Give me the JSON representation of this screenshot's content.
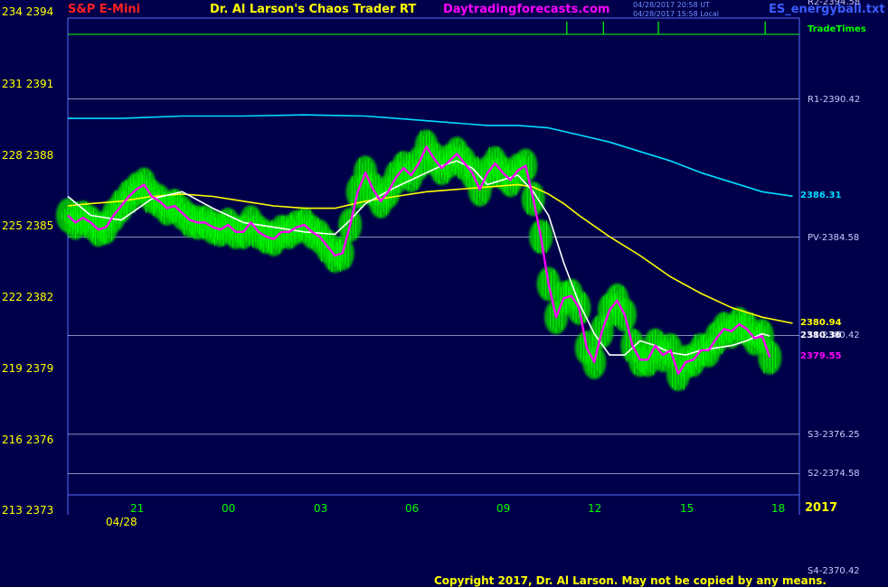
{
  "header": {
    "symbol": "S&P E-Mini",
    "app_title": "Dr. Al Larson's Chaos Trader RT",
    "website": "Daytradingforecasts.com",
    "file": "ES_energyball.txt",
    "timestamp1": "04/28/2017 20:58 UT",
    "timestamp2": "04/28/2017 15:58 Local",
    "top_left_price": "234 2394"
  },
  "trade_times_label": "TradeTimes",
  "year": "2017",
  "date_label": "04/28",
  "copyright": "Copyright 2017, Dr. Al Larson. May not be copied by any means.",
  "colors": {
    "background": "#00004a",
    "frame": "#5a6cff",
    "level_line": "#b8b8e8",
    "price": "#ff00ff",
    "fast_ma": "#ffffff",
    "slow_ma": "#ffff00",
    "long_ma": "#00ddff",
    "energy": "#00cc00",
    "energy_core": "#00ff00",
    "axis_label": "#ffff00",
    "time_label": "#00ff00",
    "trade_times": "#00ff00",
    "symbol": "#ff2020",
    "title": "#ffff00",
    "website": "#ff00ff"
  },
  "chart_data": {
    "type": "line",
    "title": "Dr. Al Larson's Chaos Trader RT",
    "xlabel": "",
    "ylabel": "",
    "ylim": [
      2373,
      2394
    ],
    "xlim": [
      18.25,
      42.8
    ],
    "grid": false,
    "y_tick_labels": [
      "213 2373",
      "216 2376",
      "219 2379",
      "222 2382",
      "225 2385",
      "228 2388",
      "231 2391"
    ],
    "y_tick_values": [
      2373,
      2376,
      2379,
      2382,
      2385,
      2388,
      2391
    ],
    "x_tick_labels": [
      "21",
      "00",
      "03",
      "06",
      "09",
      "12",
      "15",
      "18"
    ],
    "x_tick_values": [
      21,
      24,
      27,
      30,
      33,
      36,
      39,
      42
    ],
    "levels": [
      {
        "label": "R2-2394.58",
        "value": 2394.58
      },
      {
        "label": "R1-2390.42",
        "value": 2390.42
      },
      {
        "label": "PV-2384.58",
        "value": 2384.58
      },
      {
        "label": "S1-2380.42",
        "value": 2380.42
      },
      {
        "label": "S3-2376.25",
        "value": 2376.25
      },
      {
        "label": "S2-2374.58",
        "value": 2374.58
      },
      {
        "label": "S4-2370.42",
        "value": 2370.42
      }
    ],
    "end_labels": [
      {
        "label": "2386.31",
        "value": 2386.31,
        "series": "long_ma"
      },
      {
        "label": "2380.94",
        "value": 2380.94,
        "series": "slow_ma"
      },
      {
        "label": "2380.36",
        "value": 2380.36,
        "series": "fast_ma"
      },
      {
        "label": "2379.55",
        "value": 2379.55,
        "series": "price"
      }
    ],
    "trade_times": [
      34.6,
      35.8,
      37.6,
      41.1
    ],
    "series": [
      {
        "key": "price",
        "x": [
          18.25,
          18.5,
          18.75,
          19,
          19.25,
          19.5,
          19.75,
          20,
          20.25,
          20.5,
          20.75,
          21,
          21.25,
          21.5,
          21.75,
          22,
          22.25,
          22.5,
          22.75,
          23,
          23.25,
          23.5,
          23.75,
          24,
          24.25,
          24.5,
          24.75,
          25,
          25.25,
          25.5,
          25.75,
          26,
          26.25,
          26.5,
          26.75,
          27,
          27.25,
          27.5,
          27.75,
          28,
          28.25,
          28.5,
          28.75,
          29,
          29.25,
          29.5,
          29.75,
          30,
          30.25,
          30.5,
          30.75,
          31,
          31.25,
          31.5,
          31.75,
          32,
          32.25,
          32.5,
          32.75,
          33,
          33.25,
          33.5,
          33.75,
          34,
          34.25,
          34.5,
          34.75,
          35,
          35.25,
          35.5,
          35.75,
          36,
          36.25,
          36.5,
          36.75,
          37,
          37.25,
          37.5,
          37.75,
          38,
          38.25,
          38.5,
          38.75,
          39,
          39.25,
          39.5,
          39.75,
          40,
          40.25,
          40.5,
          40.75,
          41,
          41.25
        ],
        "values": [
          2385.5,
          2385.2,
          2385.4,
          2385.2,
          2384.9,
          2385,
          2385.5,
          2385.9,
          2386.3,
          2386.6,
          2386.8,
          2386.3,
          2386.1,
          2385.8,
          2385.9,
          2385.6,
          2385.3,
          2385.2,
          2385.2,
          2385,
          2384.9,
          2385.1,
          2384.8,
          2384.8,
          2385.2,
          2384.8,
          2384.6,
          2384.5,
          2384.8,
          2384.8,
          2385,
          2385.1,
          2384.8,
          2384.6,
          2384.2,
          2383.8,
          2383.9,
          2385.1,
          2386.5,
          2387.3,
          2386.6,
          2386.1,
          2386.5,
          2387.1,
          2387.5,
          2387.2,
          2387.7,
          2388.4,
          2387.9,
          2387.5,
          2387.8,
          2388.1,
          2387.7,
          2387.3,
          2386.6,
          2387.3,
          2387.7,
          2387.3,
          2387,
          2387.4,
          2387.6,
          2386.2,
          2384.6,
          2382.6,
          2381.2,
          2382,
          2382.1,
          2381.6,
          2379.9,
          2379.3,
          2380.6,
          2381.5,
          2381.9,
          2381.3,
          2380,
          2379.4,
          2379.4,
          2380,
          2379.6,
          2379.8,
          2378.8,
          2379.3,
          2379.4,
          2379.8,
          2379.8,
          2380.3,
          2380.7,
          2380.6,
          2380.9,
          2380.7,
          2380.3,
          2380.4,
          2379.5
        ]
      },
      {
        "key": "fast_ma",
        "x": [
          18.25,
          19,
          20,
          21,
          22,
          23,
          24,
          25,
          26,
          27,
          27.5,
          28,
          29,
          30,
          30.5,
          31,
          31.5,
          32,
          32.5,
          33,
          33.5,
          34,
          34.5,
          35,
          35.5,
          36,
          36.5,
          37,
          37.5,
          38,
          38.5,
          39,
          40,
          40.5,
          41,
          41.25
        ],
        "values": [
          2386.3,
          2385.5,
          2385.3,
          2386.2,
          2386.5,
          2385.8,
          2385.2,
          2385,
          2384.8,
          2384.7,
          2385.3,
          2386,
          2386.7,
          2387.3,
          2387.6,
          2387.8,
          2387.5,
          2386.8,
          2387,
          2387.2,
          2386.5,
          2385.5,
          2383.5,
          2381.8,
          2380.5,
          2379.6,
          2379.6,
          2380.2,
          2380,
          2379.7,
          2379.6,
          2379.8,
          2380,
          2380.2,
          2380.5,
          2380.4
        ]
      },
      {
        "key": "slow_ma",
        "x": [
          18.25,
          19,
          20,
          21,
          22,
          23,
          24,
          25,
          26,
          27,
          28,
          29,
          30,
          31,
          32,
          33,
          33.5,
          34,
          34.5,
          35,
          36,
          37,
          38,
          39,
          40,
          41,
          42
        ],
        "values": [
          2385.9,
          2386,
          2386.1,
          2386.3,
          2386.4,
          2386.3,
          2386.1,
          2385.9,
          2385.8,
          2385.8,
          2386.1,
          2386.3,
          2386.5,
          2386.6,
          2386.7,
          2386.8,
          2386.7,
          2386.4,
          2386,
          2385.5,
          2384.6,
          2383.8,
          2382.9,
          2382.2,
          2381.6,
          2381.2,
          2380.94
        ]
      },
      {
        "key": "long_ma",
        "x": [
          18.25,
          20,
          22,
          24,
          26,
          28,
          29,
          30,
          31,
          32,
          33,
          34,
          35,
          36,
          37,
          38,
          39,
          40,
          41,
          42
        ],
        "values": [
          2389.6,
          2389.6,
          2389.7,
          2389.7,
          2389.75,
          2389.7,
          2389.6,
          2389.5,
          2389.4,
          2389.3,
          2389.3,
          2389.2,
          2388.9,
          2388.6,
          2388.2,
          2387.8,
          2387.3,
          2386.9,
          2386.5,
          2386.31
        ]
      }
    ]
  }
}
